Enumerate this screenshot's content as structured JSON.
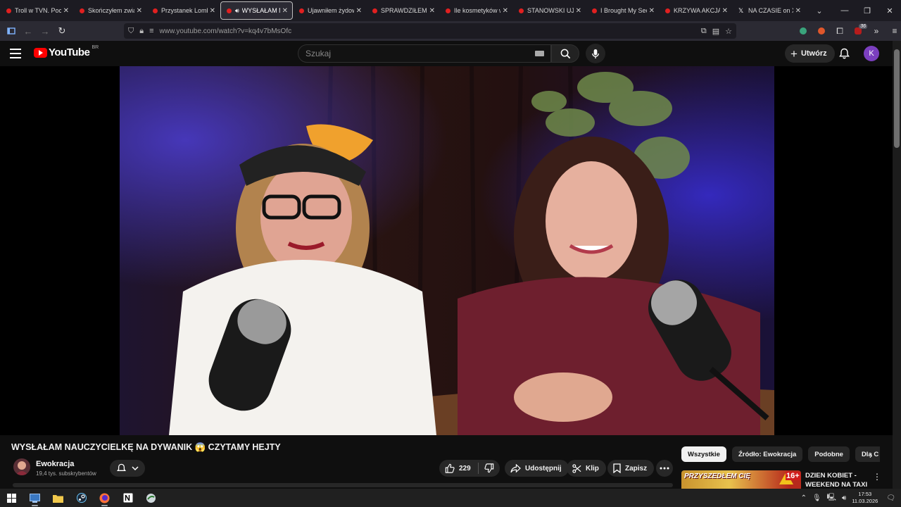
{
  "browser": {
    "tabs": [
      {
        "title": "Troll w TVN. Poczuł",
        "favicon": "youtube-icon",
        "active": false
      },
      {
        "title": "Skończyłem związek",
        "favicon": "youtube-icon",
        "active": false
      },
      {
        "title": "Przystanek Lombard",
        "favicon": "youtube-icon",
        "active": false
      },
      {
        "title": "WYSŁAŁAM N",
        "favicon": "youtube-icon",
        "active": true,
        "playing_audio": true
      },
      {
        "title": "Ujawniłem żydowsk",
        "favicon": "youtube-icon",
        "active": false
      },
      {
        "title": "SPRAWDZIŁEM CZ",
        "favicon": "youtube-icon",
        "active": false
      },
      {
        "title": "Ile kosmetyków w",
        "favicon": "youtube-icon",
        "active": false
      },
      {
        "title": "STANOWSKI UJAW",
        "favicon": "youtube-icon",
        "active": false
      },
      {
        "title": "I Brought My Secret",
        "favicon": "youtube-icon",
        "active": false
      },
      {
        "title": "KRZYWA AKCJA #",
        "favicon": "youtube-icon",
        "active": false
      },
      {
        "title": "NA CZASIE on X: ",
        "favicon": "x-icon",
        "active": false
      }
    ],
    "url": "www.youtube.com/watch?v=kq4v7bMsOfc",
    "extension_badge": "36"
  },
  "youtube": {
    "logo_text": "YouTube",
    "country_code": "BR",
    "search_placeholder": "Szukaj",
    "create_label": "Utwórz",
    "avatar_letter": "K",
    "accent_color": "#ff0000"
  },
  "video": {
    "title": "WYSŁAŁAM NAUCZYCIELKĘ NA DYWANIK 😱 CZYTAMY HEJTY",
    "channel_name": "Ewokracja",
    "subscribers": "19,4 tys. subskrybentów",
    "likes": "229",
    "share_label": "Udostępnij",
    "clip_label": "Klip",
    "save_label": "Zapisz"
  },
  "sidebar": {
    "chips": [
      "Wszystkie",
      "Źródło: Ewokracja",
      "Podobne",
      "Dla C"
    ],
    "recommendation": {
      "thumb_text": "PRZYSZEDŁEM CIĘ",
      "age_badge": "16+",
      "title": "DZIEN KOBIET - WEEKEND NA TAXI"
    }
  },
  "taskbar": {
    "time": "17:53",
    "date": "11.03.2026"
  }
}
